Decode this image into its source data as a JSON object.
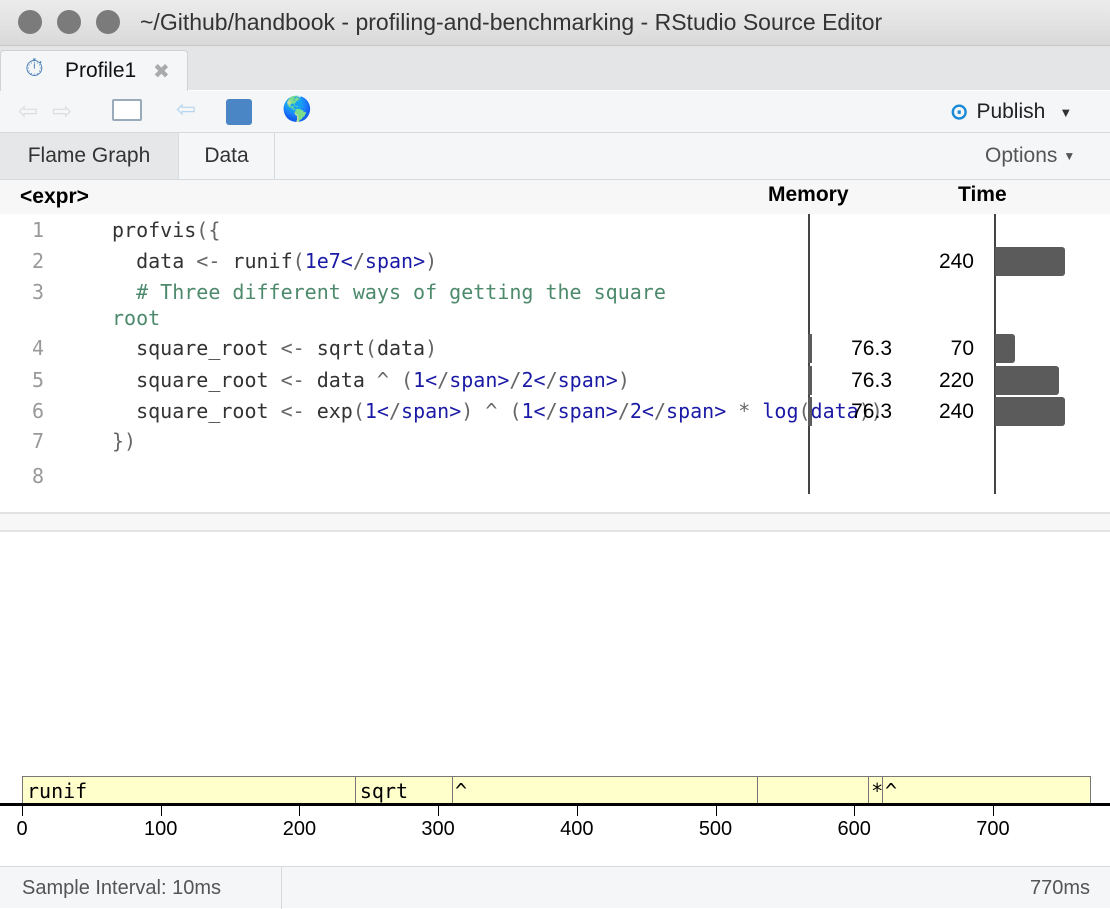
{
  "window": {
    "title": "~/Github/handbook - profiling-and-benchmarking - RStudio Source Editor"
  },
  "tab": {
    "label": "Profile1",
    "icon": "stopwatch-icon"
  },
  "toolbar": {
    "publish_label": "Publish"
  },
  "subtabs": [
    {
      "label": "Flame Graph",
      "active": true
    },
    {
      "label": "Data",
      "active": false
    }
  ],
  "options_label": "Options",
  "header": {
    "expr": "<expr>",
    "memory": "Memory",
    "time": "Time"
  },
  "code_lines": [
    {
      "n": "1",
      "text": "profvis({"
    },
    {
      "n": "2",
      "text": "  data <- runif(1e7)",
      "time": 240
    },
    {
      "n": "3",
      "text": "  # Three different ways of getting the square",
      "cont": "root"
    },
    {
      "n": "4",
      "text": "  square_root <- sqrt(data)",
      "memory": "76.3",
      "time": 70
    },
    {
      "n": "5",
      "text": "  square_root <- data ^ (1/2)",
      "memory": "76.3",
      "time": 220
    },
    {
      "n": "6",
      "text": "  square_root <- exp(1) ^ (1/2 * log(data))",
      "memory": "76.3",
      "time": 240
    },
    {
      "n": "7",
      "text": "})"
    },
    {
      "n": "8",
      "text": ""
    }
  ],
  "chart_data": {
    "type": "flame",
    "blocks": [
      {
        "label": "runif",
        "start": 0,
        "end": 240
      },
      {
        "label": "sqrt",
        "start": 240,
        "end": 310
      },
      {
        "label": "^",
        "start": 310,
        "end": 530
      },
      {
        "label": "",
        "start": 530,
        "end": 610
      },
      {
        "label": "*",
        "start": 610,
        "end": 620
      },
      {
        "label": "^",
        "start": 620,
        "end": 770
      }
    ],
    "ticks": [
      "0",
      "100",
      "200",
      "300",
      "400",
      "500",
      "600",
      "700"
    ],
    "xlim": [
      0,
      770
    ],
    "color": "#ffffcc"
  },
  "status": {
    "sample_interval": "Sample Interval: 10ms",
    "total": "770ms"
  }
}
